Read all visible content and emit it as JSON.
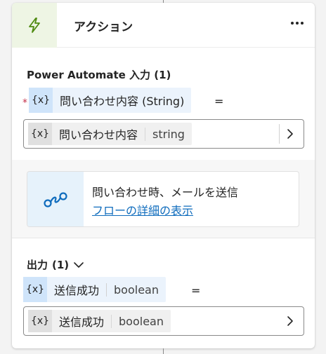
{
  "card": {
    "title": "アクション",
    "accent_color": "#eef5e4",
    "icon": "lightning-icon"
  },
  "inputs": {
    "title": "Power Automate 入力",
    "count": "(1)",
    "param": {
      "required": "*",
      "var_icon": "{x}",
      "label": "問い合わせ内容 (String)",
      "equals": "="
    },
    "value": {
      "var_icon": "{x}",
      "label": "問い合わせ内容",
      "type": "string"
    }
  },
  "flow": {
    "icon": "flow-icon",
    "name": "問い合わせ時、メールを送信",
    "link": "フローの詳細の表示"
  },
  "outputs": {
    "title": "出力",
    "count": "(1)",
    "param": {
      "var_icon": "{x}",
      "label": "送信成功",
      "type": "boolean",
      "equals": "="
    },
    "value": {
      "var_icon": "{x}",
      "label": "送信成功",
      "type": "boolean"
    }
  }
}
